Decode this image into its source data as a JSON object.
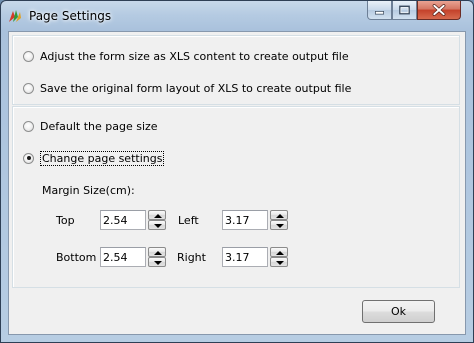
{
  "window": {
    "title": "Page Settings"
  },
  "options": {
    "adjust_form_size": "Adjust the form size as XLS content to create output file",
    "save_original_layout": "Save the original form layout of XLS to create output file",
    "default_page_size": "Default the page size",
    "change_page_settings": "Change page settings",
    "selected": "change_page_settings"
  },
  "margins": {
    "heading": "Margin Size(cm):",
    "top_label": "Top",
    "top_value": "2.54",
    "left_label": "Left",
    "left_value": "3.17",
    "bottom_label": "Bottom",
    "bottom_value": "2.54",
    "right_label": "Right",
    "right_value": "3.17"
  },
  "buttons": {
    "ok": "Ok"
  }
}
